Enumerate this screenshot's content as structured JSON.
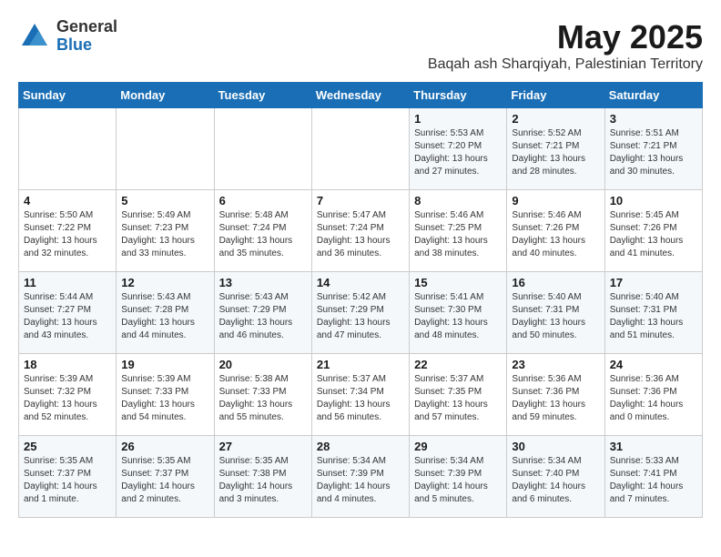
{
  "header": {
    "logo_general": "General",
    "logo_blue": "Blue",
    "month_title": "May 2025",
    "subtitle": "Baqah ash Sharqiyah, Palestinian Territory"
  },
  "weekdays": [
    "Sunday",
    "Monday",
    "Tuesday",
    "Wednesday",
    "Thursday",
    "Friday",
    "Saturday"
  ],
  "weeks": [
    [
      {
        "day": "",
        "content": ""
      },
      {
        "day": "",
        "content": ""
      },
      {
        "day": "",
        "content": ""
      },
      {
        "day": "",
        "content": ""
      },
      {
        "day": "1",
        "content": "Sunrise: 5:53 AM\nSunset: 7:20 PM\nDaylight: 13 hours\nand 27 minutes."
      },
      {
        "day": "2",
        "content": "Sunrise: 5:52 AM\nSunset: 7:21 PM\nDaylight: 13 hours\nand 28 minutes."
      },
      {
        "day": "3",
        "content": "Sunrise: 5:51 AM\nSunset: 7:21 PM\nDaylight: 13 hours\nand 30 minutes."
      }
    ],
    [
      {
        "day": "4",
        "content": "Sunrise: 5:50 AM\nSunset: 7:22 PM\nDaylight: 13 hours\nand 32 minutes."
      },
      {
        "day": "5",
        "content": "Sunrise: 5:49 AM\nSunset: 7:23 PM\nDaylight: 13 hours\nand 33 minutes."
      },
      {
        "day": "6",
        "content": "Sunrise: 5:48 AM\nSunset: 7:24 PM\nDaylight: 13 hours\nand 35 minutes."
      },
      {
        "day": "7",
        "content": "Sunrise: 5:47 AM\nSunset: 7:24 PM\nDaylight: 13 hours\nand 36 minutes."
      },
      {
        "day": "8",
        "content": "Sunrise: 5:46 AM\nSunset: 7:25 PM\nDaylight: 13 hours\nand 38 minutes."
      },
      {
        "day": "9",
        "content": "Sunrise: 5:46 AM\nSunset: 7:26 PM\nDaylight: 13 hours\nand 40 minutes."
      },
      {
        "day": "10",
        "content": "Sunrise: 5:45 AM\nSunset: 7:26 PM\nDaylight: 13 hours\nand 41 minutes."
      }
    ],
    [
      {
        "day": "11",
        "content": "Sunrise: 5:44 AM\nSunset: 7:27 PM\nDaylight: 13 hours\nand 43 minutes."
      },
      {
        "day": "12",
        "content": "Sunrise: 5:43 AM\nSunset: 7:28 PM\nDaylight: 13 hours\nand 44 minutes."
      },
      {
        "day": "13",
        "content": "Sunrise: 5:43 AM\nSunset: 7:29 PM\nDaylight: 13 hours\nand 46 minutes."
      },
      {
        "day": "14",
        "content": "Sunrise: 5:42 AM\nSunset: 7:29 PM\nDaylight: 13 hours\nand 47 minutes."
      },
      {
        "day": "15",
        "content": "Sunrise: 5:41 AM\nSunset: 7:30 PM\nDaylight: 13 hours\nand 48 minutes."
      },
      {
        "day": "16",
        "content": "Sunrise: 5:40 AM\nSunset: 7:31 PM\nDaylight: 13 hours\nand 50 minutes."
      },
      {
        "day": "17",
        "content": "Sunrise: 5:40 AM\nSunset: 7:31 PM\nDaylight: 13 hours\nand 51 minutes."
      }
    ],
    [
      {
        "day": "18",
        "content": "Sunrise: 5:39 AM\nSunset: 7:32 PM\nDaylight: 13 hours\nand 52 minutes."
      },
      {
        "day": "19",
        "content": "Sunrise: 5:39 AM\nSunset: 7:33 PM\nDaylight: 13 hours\nand 54 minutes."
      },
      {
        "day": "20",
        "content": "Sunrise: 5:38 AM\nSunset: 7:33 PM\nDaylight: 13 hours\nand 55 minutes."
      },
      {
        "day": "21",
        "content": "Sunrise: 5:37 AM\nSunset: 7:34 PM\nDaylight: 13 hours\nand 56 minutes."
      },
      {
        "day": "22",
        "content": "Sunrise: 5:37 AM\nSunset: 7:35 PM\nDaylight: 13 hours\nand 57 minutes."
      },
      {
        "day": "23",
        "content": "Sunrise: 5:36 AM\nSunset: 7:36 PM\nDaylight: 13 hours\nand 59 minutes."
      },
      {
        "day": "24",
        "content": "Sunrise: 5:36 AM\nSunset: 7:36 PM\nDaylight: 14 hours\nand 0 minutes."
      }
    ],
    [
      {
        "day": "25",
        "content": "Sunrise: 5:35 AM\nSunset: 7:37 PM\nDaylight: 14 hours\nand 1 minute."
      },
      {
        "day": "26",
        "content": "Sunrise: 5:35 AM\nSunset: 7:37 PM\nDaylight: 14 hours\nand 2 minutes."
      },
      {
        "day": "27",
        "content": "Sunrise: 5:35 AM\nSunset: 7:38 PM\nDaylight: 14 hours\nand 3 minutes."
      },
      {
        "day": "28",
        "content": "Sunrise: 5:34 AM\nSunset: 7:39 PM\nDaylight: 14 hours\nand 4 minutes."
      },
      {
        "day": "29",
        "content": "Sunrise: 5:34 AM\nSunset: 7:39 PM\nDaylight: 14 hours\nand 5 minutes."
      },
      {
        "day": "30",
        "content": "Sunrise: 5:34 AM\nSunset: 7:40 PM\nDaylight: 14 hours\nand 6 minutes."
      },
      {
        "day": "31",
        "content": "Sunrise: 5:33 AM\nSunset: 7:41 PM\nDaylight: 14 hours\nand 7 minutes."
      }
    ]
  ]
}
